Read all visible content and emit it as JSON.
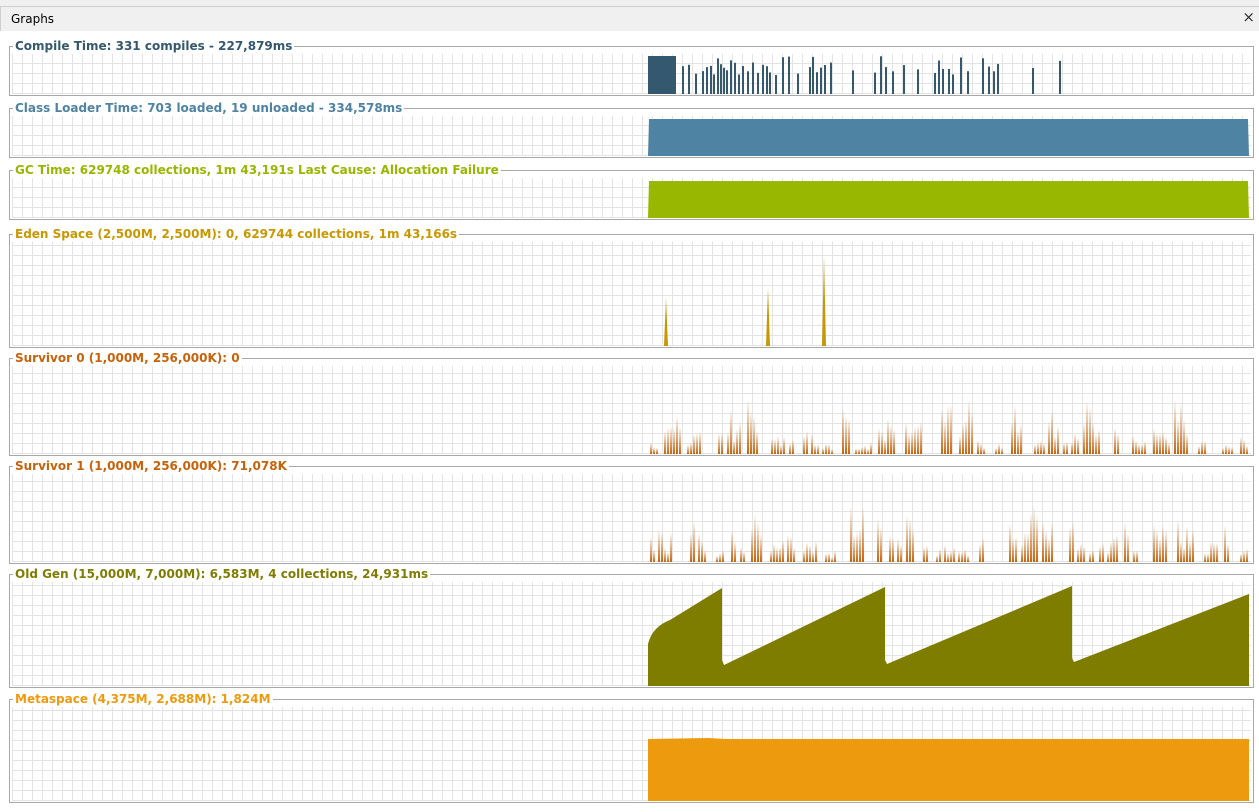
{
  "window": {
    "tab_title": "Graphs",
    "close_label": "×"
  },
  "graphs": [
    {
      "id": "compile",
      "title": "Compile Time: 331 compiles - 227,879ms",
      "color": "#34586e",
      "style": "compile"
    },
    {
      "id": "classloader",
      "title": "Class Loader Time: 703 loaded, 19 unloaded - 334,578ms",
      "color": "#4f83a3",
      "style": "solid"
    },
    {
      "id": "gc",
      "title": "GC Time: 629748 collections, 1m 43,191s  Last Cause: Allocation Failure",
      "color": "#98b700",
      "style": "solid"
    },
    {
      "id": "eden",
      "title": "Eden Space (2,500M, 2,500M): 0, 629744 collections, 1m 43,166s",
      "color": "#c99700",
      "style": "eden"
    },
    {
      "id": "survivor0",
      "title": "Survivor 0 (1,000M, 256,000K): 0",
      "color": "#c8620a",
      "style": "spiky"
    },
    {
      "id": "survivor1",
      "title": "Survivor 1 (1,000M, 256,000K): 71,078K",
      "color": "#c8620a",
      "style": "spiky"
    },
    {
      "id": "oldgen",
      "title": "Old Gen (15,000M, 7,000M): 6,583M, 4 collections, 24,931ms",
      "color": "#7f7d00",
      "style": "sawtooth"
    },
    {
      "id": "metaspace",
      "title": "Metaspace (4,375M, 2,688M): 1,824M",
      "color": "#ee9a0e",
      "style": "meta"
    }
  ]
}
